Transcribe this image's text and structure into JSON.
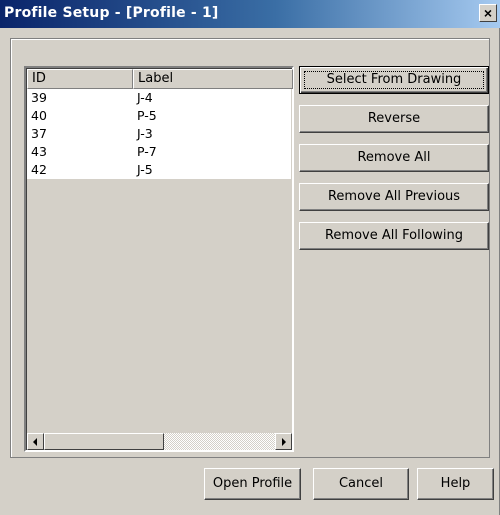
{
  "window": {
    "title": "Profile Setup - [Profile - 1]",
    "close_glyph": "×"
  },
  "list": {
    "columns": [
      "ID",
      "Label"
    ],
    "rows": [
      {
        "id": "39",
        "label": "J-4"
      },
      {
        "id": "40",
        "label": "P-5"
      },
      {
        "id": "37",
        "label": "J-3"
      },
      {
        "id": "43",
        "label": "P-7"
      },
      {
        "id": "42",
        "label": "J-5"
      }
    ]
  },
  "actions": {
    "select_from_drawing": "Select From Drawing",
    "reverse": "Reverse",
    "remove_all": "Remove All",
    "remove_all_previous": "Remove All Previous",
    "remove_all_following": "Remove All Following"
  },
  "footer": {
    "open_profile": "Open Profile",
    "cancel": "Cancel",
    "help": "Help"
  },
  "colors": {
    "title_gradient_start": "#0a246a",
    "title_gradient_end": "#a6caf0",
    "dialog_face": "#d4d0c8",
    "list_background": "#ffffff"
  }
}
